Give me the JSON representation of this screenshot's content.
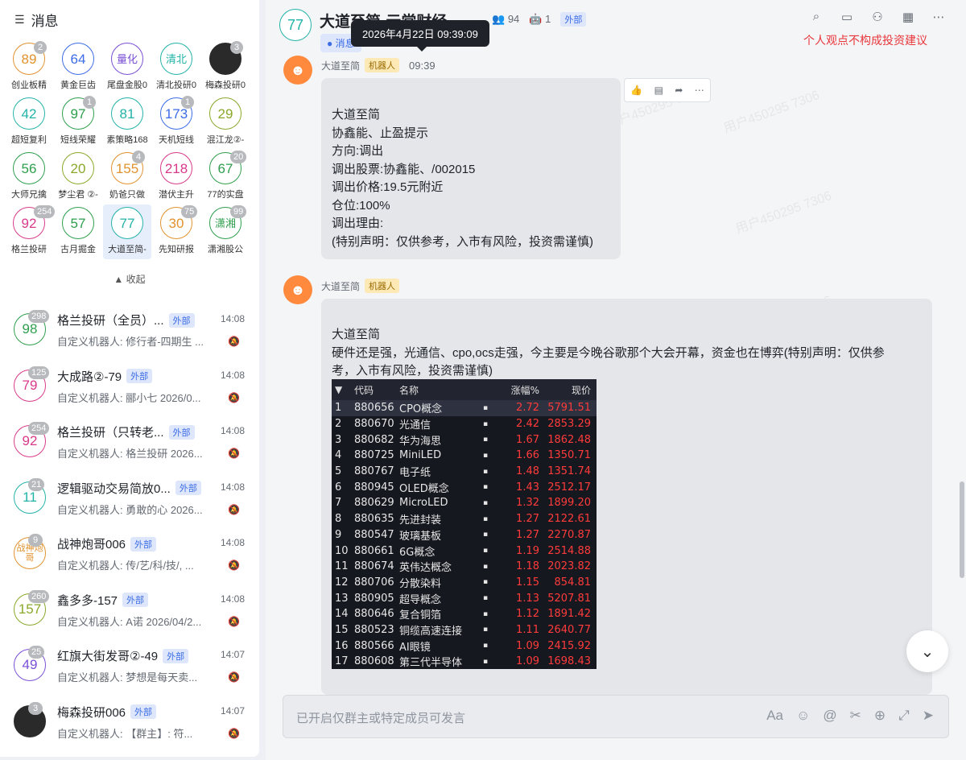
{
  "sidebar": {
    "title": "消息",
    "collapse_label": "收起",
    "grid": [
      {
        "avatar": "89",
        "label": "创业板精",
        "badge": "2",
        "color": "#e0922e"
      },
      {
        "avatar": "64",
        "label": "黄金巨齿",
        "badge": "",
        "color": "#3b6ce6"
      },
      {
        "avatar": "量化",
        "label": "尾盘金股0",
        "badge": "",
        "color": "#7a4fd6"
      },
      {
        "avatar": "清北",
        "label": "清北投研0",
        "badge": "",
        "color": "#22b3a8"
      },
      {
        "avatar": "",
        "label": "梅森投研0",
        "badge": "3",
        "color": "#2a2a2a",
        "dark": true
      },
      {
        "avatar": "42",
        "label": "超短复利",
        "badge": "",
        "color": "#22b3a8"
      },
      {
        "avatar": "97",
        "label": "短线荣耀",
        "badge": "1",
        "color": "#2e9e4d"
      },
      {
        "avatar": "81",
        "label": "素策略168",
        "badge": "",
        "color": "#22b3a8"
      },
      {
        "avatar": "173",
        "label": "天机短线",
        "badge": "1",
        "color": "#3b6ce6"
      },
      {
        "avatar": "29",
        "label": "混江龙②-",
        "badge": "",
        "color": "#8aa82a"
      },
      {
        "avatar": "56",
        "label": "大师兄擒",
        "badge": "",
        "color": "#2e9e4d"
      },
      {
        "avatar": "20",
        "label": "梦尘君 ②-",
        "badge": "",
        "color": "#8aa82a"
      },
      {
        "avatar": "155",
        "label": "奶爸只做",
        "badge": "4",
        "color": "#e0922e"
      },
      {
        "avatar": "218",
        "label": "潜伏主升",
        "badge": "",
        "color": "#d9398a"
      },
      {
        "avatar": "67",
        "label": "77的实盘",
        "badge": "20",
        "color": "#2e9e4d"
      },
      {
        "avatar": "92",
        "label": "格兰投研",
        "badge": "254",
        "color": "#d9398a"
      },
      {
        "avatar": "57",
        "label": "古月掘金",
        "badge": "",
        "color": "#2e9e4d"
      },
      {
        "avatar": "77",
        "label": "大道至简-",
        "badge": "",
        "color": "#22b3a8",
        "active": true
      },
      {
        "avatar": "30",
        "label": "先知研报",
        "badge": "75",
        "color": "#e0922e"
      },
      {
        "avatar": "潇湘",
        "label": "潇湘股公",
        "badge": "99",
        "color": "#2e9e4d"
      }
    ],
    "chats": [
      {
        "avatar": "98",
        "badge": "298",
        "name": "格兰投研（全员）...",
        "ext": "外部",
        "time": "14:08",
        "preview": "自定义机器人: 修行者-四期生 ...",
        "color": "#2e9e4d"
      },
      {
        "avatar": "79",
        "badge": "125",
        "name": "大成路②-79",
        "ext": "外部",
        "time": "14:08",
        "preview": "自定义机器人: 郦小七 2026/0...",
        "color": "#d9398a"
      },
      {
        "avatar": "92",
        "badge": "254",
        "name": "格兰投研（只转老...",
        "ext": "外部",
        "time": "14:08",
        "preview": "自定义机器人: 格兰投研 2026...",
        "color": "#d9398a"
      },
      {
        "avatar": "11",
        "badge": "21",
        "name": "逻辑驱动交易简放0...",
        "ext": "外部",
        "time": "14:08",
        "preview": "自定义机器人: 勇敢的心 2026...",
        "color": "#22b3a8"
      },
      {
        "avatar": "战神炮哥",
        "badge": "9",
        "name": "战神炮哥006",
        "ext": "外部",
        "time": "14:08",
        "preview": "自定义机器人: 传/艺/科/技/, ...",
        "color": "#e0922e"
      },
      {
        "avatar": "157",
        "badge": "260",
        "name": "鑫多多-157",
        "ext": "外部",
        "time": "14:08",
        "preview": "自定义机器人: A诺 2026/04/2...",
        "color": "#8aa82a"
      },
      {
        "avatar": "49",
        "badge": "25",
        "name": "红旗大街发哥②-49",
        "ext": "外部",
        "time": "14:07",
        "preview": "自定义机器人: 梦想是每天卖...",
        "color": "#7a4fd6"
      },
      {
        "avatar": "",
        "badge": "3",
        "name": "梅森投研006",
        "ext": "外部",
        "time": "14:07",
        "preview": "自定义机器人: 【群主】: 符...",
        "color": "#2a2a2a",
        "dark": true
      }
    ]
  },
  "header": {
    "avatar": "77",
    "title": "大道至简-元常财经",
    "members": "94",
    "bots": "1",
    "ext": "外部",
    "tab": "消息",
    "tooltip": "2026年4月22日 09:39:09",
    "disclaimer": "个人观点不构成投资建议"
  },
  "messages": [
    {
      "sender": "大道至简",
      "tag": "机器人",
      "time": "09:39",
      "lines": [
        "大道至简",
        "协鑫能、止盈提示",
        "方向:调出",
        "调出股票:协鑫能、/002015",
        "调出价格:19.5元附近",
        "仓位:100%",
        "调出理由:",
        "(特别声明：仅供参考，入市有风险，投资需谨慎)"
      ]
    },
    {
      "sender": "大道至简",
      "tag": "机器人",
      "lines": [
        "大道至简",
        "硬件还是强，光通信、cpo,ocs走强，今主要是今晚谷歌那个大会开幕，资金也在博弈(特别声明：仅供参",
        "考，入市有风险，投资需谨慎)"
      ]
    }
  ],
  "stock_table": {
    "headers": [
      "代码",
      "名称",
      "涨幅%",
      "现价"
    ],
    "rows": [
      [
        "1",
        "880656",
        "CPO概念",
        "2.72",
        "5791.51"
      ],
      [
        "2",
        "880670",
        "光通信",
        "2.42",
        "2853.29"
      ],
      [
        "3",
        "880682",
        "华为海思",
        "1.67",
        "1862.48"
      ],
      [
        "4",
        "880725",
        "MiniLED",
        "1.66",
        "1350.71"
      ],
      [
        "5",
        "880767",
        "电子纸",
        "1.48",
        "1351.74"
      ],
      [
        "6",
        "880945",
        "OLED概念",
        "1.43",
        "2512.17"
      ],
      [
        "7",
        "880629",
        "MicroLED",
        "1.32",
        "1899.20"
      ],
      [
        "8",
        "880635",
        "先进封装",
        "1.27",
        "2122.61"
      ],
      [
        "9",
        "880547",
        "玻璃基板",
        "1.27",
        "2270.87"
      ],
      [
        "10",
        "880661",
        "6G概念",
        "1.19",
        "2514.88"
      ],
      [
        "11",
        "880674",
        "英伟达概念",
        "1.18",
        "2023.82"
      ],
      [
        "12",
        "880706",
        "分散染料",
        "1.15",
        "854.81"
      ],
      [
        "13",
        "880905",
        "超导概念",
        "1.13",
        "5207.81"
      ],
      [
        "14",
        "880646",
        "复合铜箔",
        "1.12",
        "1891.42"
      ],
      [
        "15",
        "880523",
        "铜缆高速连接",
        "1.11",
        "2640.77"
      ],
      [
        "16",
        "880566",
        "AI眼镜",
        "1.09",
        "2415.92"
      ],
      [
        "17",
        "880608",
        "第三代半导体",
        "1.09",
        "1698.43"
      ]
    ]
  },
  "input": {
    "placeholder": "已开启仅群主或特定成员可发言"
  },
  "watermark": "用户450295 7306"
}
